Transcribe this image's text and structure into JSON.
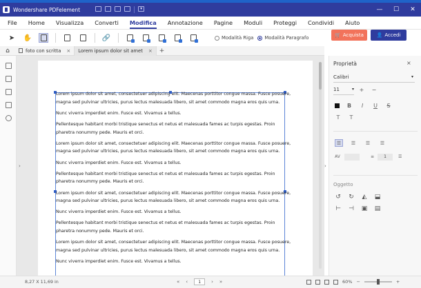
{
  "app": {
    "title": "Wondershare PDFelement",
    "window_controls": [
      "—",
      "☐",
      "✕"
    ]
  },
  "menu": {
    "items": [
      "File",
      "Home",
      "Visualizza",
      "Converti",
      "Modifica",
      "Annotazione",
      "Pagine",
      "Moduli",
      "Proteggi",
      "Condividi",
      "Aiuto"
    ],
    "active": "Modifica"
  },
  "toolbar": {
    "mode_line": "Modalità Riga",
    "mode_paragraph": "Modalità Paragrafo",
    "buy_label": "Acquista",
    "login_label": "Accedi"
  },
  "tabs": [
    {
      "label": "foto con scritta"
    },
    {
      "label": "Lorem ipsum dolor sit amet"
    }
  ],
  "document": {
    "paragraphs": [
      "Lorem ipsum dolor sit amet, consectetuer adipiscing elit. Maecenas porttitor congue massa. Fusce posuere,\nmagna sed pulvinar ultricies, purus lectus malesuada libero, sit amet commodo magna eros quis urna.",
      "Nunc viverra imperdiet enim. Fusce est. Vivamus a tellus.",
      "Pellentesque habitant morbi tristique senectus et netus et malesuada fames ac turpis egestas. Proin\npharetra nonummy pede. Mauris et orci.",
      "Lorem ipsum dolor sit amet, consectetuer adipiscing elit. Maecenas porttitor congue massa. Fusce posuere,\nmagna sed pulvinar ultricies, purus lectus malesuada libero, sit amet commodo magna eros quis urna.",
      "Nunc viverra imperdiet enim. Fusce est. Vivamus a tellus.",
      "Pellentesque habitant morbi tristique senectus et netus et malesuada fames ac turpis egestas. Proin\npharetra nonummy pede. Mauris et orci.",
      "Lorem ipsum dolor sit amet, consectetuer adipiscing elit. Maecenas porttitor congue massa. Fusce posuere,\nmagna sed pulvinar ultricies, purus lectus malesuada libero, sit amet commodo magna eros quis urna.",
      "Nunc viverra imperdiet enim. Fusce est. Vivamus a tellus.",
      "Pellentesque habitant morbi tristique senectus et netus et malesuada fames ac turpis egestas. Proin\npharetra nonummy pede. Mauris et orci.",
      "Lorem ipsum dolor sit amet, consectetuer adipiscing elit. Maecenas porttitor congue massa. Fusce posuere,\nmagna sed pulvinar ultricies, purus lectus malesuada libero, sit amet commodo magna eros quis urna.",
      "Nunc viverra imperdiet enim. Fusce est. Vivamus a tellus."
    ]
  },
  "properties": {
    "title": "Proprietà",
    "font_name": "Calibri",
    "font_size": "11",
    "spacing_value": "1",
    "object_section": "Oggetto"
  },
  "status": {
    "page_size": "8,27 X 11,69 in",
    "page_number": "1",
    "zoom": "60%"
  },
  "colors": {
    "brand": "#2f3c9e",
    "buy_button": "#f2735b",
    "desktop": "#1f63c9"
  }
}
